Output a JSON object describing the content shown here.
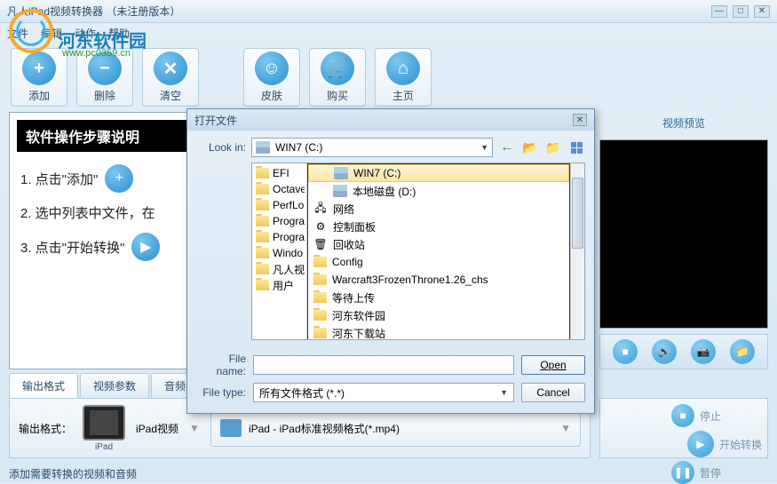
{
  "window": {
    "title": "凡人iPad视频转换器 （未注册版本）"
  },
  "watermark": {
    "text": "河东软件园",
    "url": "www.pc0359.cn"
  },
  "menu": {
    "file": "文件",
    "edit": "编辑",
    "action": "动作",
    "help": "帮助"
  },
  "toolbar": {
    "add": "添加",
    "delete": "删除",
    "clear": "清空",
    "skin": "皮肤",
    "buy": "购买",
    "home": "主页"
  },
  "instructions": {
    "header": "软件操作步骤说明",
    "step1": "1. 点击\"添加\"",
    "step2": "2. 选中列表中文件，在",
    "step3": "3. 点击\"开始转换\""
  },
  "preview": {
    "label": "视频预览"
  },
  "tabs": {
    "outputFormat": "输出格式",
    "videoParams": "视频参数",
    "audioParams": "音频参数"
  },
  "format": {
    "label": "输出格式：",
    "deviceName": "iPad",
    "deviceLabel": "iPad视频",
    "formatText": "iPad - iPad标准视频格式(*.mp4)"
  },
  "actions": {
    "stop": "停止",
    "start": "开始转换",
    "pause": "暂停"
  },
  "statusBar": "添加需要转换的视频和音频",
  "dialog": {
    "title": "打开文件",
    "lookIn": "Look in:",
    "currentDrive": "WIN7 (C:)",
    "leftFolders": [
      "EFI",
      "Octave",
      "PerfLo",
      "Progra",
      "Progra",
      "Windo",
      "凡人视",
      "用户"
    ],
    "dropdownItems": [
      {
        "icon": "drive",
        "text": "WIN7 (C:)",
        "indent": 1,
        "selected": true
      },
      {
        "icon": "drive",
        "text": "本地磁盘 (D:)",
        "indent": 1
      },
      {
        "icon": "network",
        "text": "网络",
        "indent": 0
      },
      {
        "icon": "control",
        "text": "控制面板",
        "indent": 0
      },
      {
        "icon": "recycle",
        "text": "回收站",
        "indent": 0
      },
      {
        "icon": "folder",
        "text": "Config",
        "indent": 0
      },
      {
        "icon": "folder",
        "text": "Warcraft3FrozenThrone1.26_chs",
        "indent": 0
      },
      {
        "icon": "folder",
        "text": "等待上传",
        "indent": 0
      },
      {
        "icon": "folder",
        "text": "河东软件园",
        "indent": 0
      },
      {
        "icon": "folder",
        "text": "河东下载站",
        "indent": 0
      }
    ],
    "fileNameLabel": "File name:",
    "fileName": "",
    "fileTypeLabel": "File type:",
    "fileType": "所有文件格式 (*.*)",
    "openBtn": "Open",
    "cancelBtn": "Cancel"
  }
}
